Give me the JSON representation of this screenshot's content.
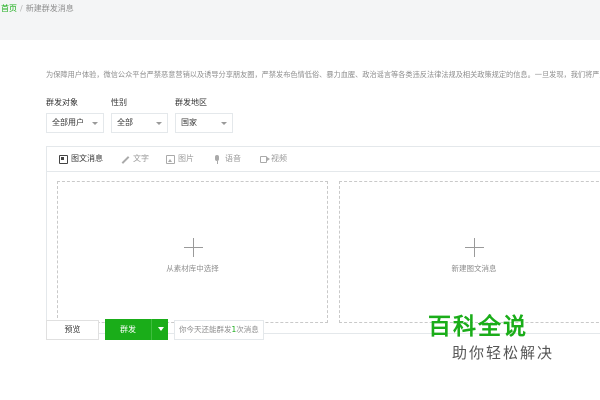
{
  "breadcrumb": {
    "home": "首页",
    "separator": "/",
    "current": "新建群发消息"
  },
  "notice": "为保障用户体验，微信公众平台严禁恶意营销以及诱导分享朋友圈，严禁发布色情低俗、暴力血腥、政治谣言等各类违反法律法规及相关政策规定的信息。一旦发现，我们将严厉打击和处理。",
  "filters": [
    {
      "label": "群发对象",
      "value": "全部用户"
    },
    {
      "label": "性别",
      "value": "全部"
    },
    {
      "label": "群发地区",
      "value": "国家"
    }
  ],
  "tabs": [
    {
      "label": "图文消息",
      "icon": "news-icon",
      "active": true
    },
    {
      "label": "文字",
      "icon": "pen-icon"
    },
    {
      "label": "图片",
      "icon": "image-icon"
    },
    {
      "label": "语音",
      "icon": "microphone-icon"
    },
    {
      "label": "视频",
      "icon": "video-icon"
    }
  ],
  "pickers": {
    "library": "从素材库中选择",
    "new_article": "新建图文消息"
  },
  "actions": {
    "preview": "预览",
    "send": "群发",
    "quota_prefix": "你今天还能群发",
    "quota_count": "1",
    "quota_suffix": "次消息"
  },
  "watermark": {
    "title": "百科全说",
    "subtitle": "助你轻松解决"
  },
  "colors": {
    "accent": "#1aad19",
    "border": "#e4e8eb",
    "background": "#f4f5f6"
  }
}
